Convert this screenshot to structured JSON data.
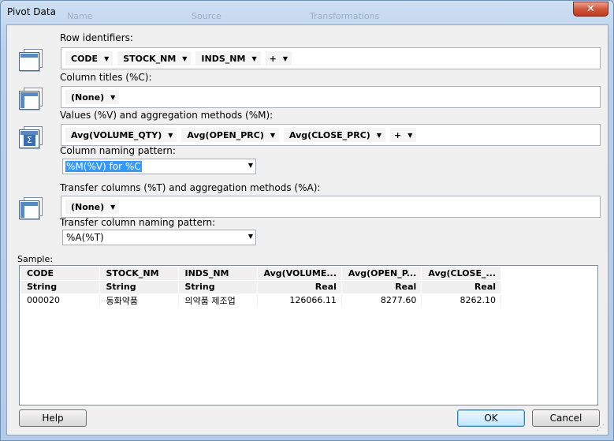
{
  "window": {
    "title": "Pivot Data",
    "close_glyph": "✕",
    "background_tabs": [
      "Name",
      "Source",
      "Transformations"
    ]
  },
  "row_identifiers": {
    "label": "Row identifiers:",
    "tokens": [
      "CODE",
      "STOCK_NM",
      "INDS_NM"
    ],
    "add_token": "+"
  },
  "column_titles": {
    "label": "Column titles (%C):",
    "tokens": [
      "(None)"
    ]
  },
  "values": {
    "label": "Values (%V) and aggregation methods (%M):",
    "tokens": [
      "Avg(VOLUME_QTY)",
      "Avg(OPEN_PRC)",
      "Avg(CLOSE_PRC)"
    ],
    "add_token": "+"
  },
  "column_naming": {
    "label": "Column naming pattern:",
    "value": "%M(%V) for %C"
  },
  "transfer_columns": {
    "label": "Transfer columns (%T) and aggregation methods (%A):",
    "tokens": [
      "(None)"
    ]
  },
  "transfer_naming": {
    "label": "Transfer column naming pattern:",
    "value": "%A(%T)"
  },
  "sample": {
    "label": "Sample:",
    "columns": [
      "CODE",
      "STOCK_NM",
      "INDS_NM",
      "Avg(VOLUME...",
      "Avg(OPEN_P...",
      "Avg(CLOSE_..."
    ],
    "types": [
      "String",
      "String",
      "String",
      "Real",
      "Real",
      "Real"
    ],
    "rows": [
      [
        "000020",
        "동화약품",
        "의약품 제조업",
        "126066.11",
        "8277.60",
        "8262.10"
      ]
    ]
  },
  "buttons": {
    "help": "Help",
    "ok": "OK",
    "cancel": "Cancel"
  },
  "icons": {
    "dropdown": "chevron-down-icon",
    "row_icon": "row-layout-icon",
    "column_icon": "column-layout-icon",
    "values_icon": "sigma-icon",
    "transfer_icon": "transfer-layout-icon"
  }
}
